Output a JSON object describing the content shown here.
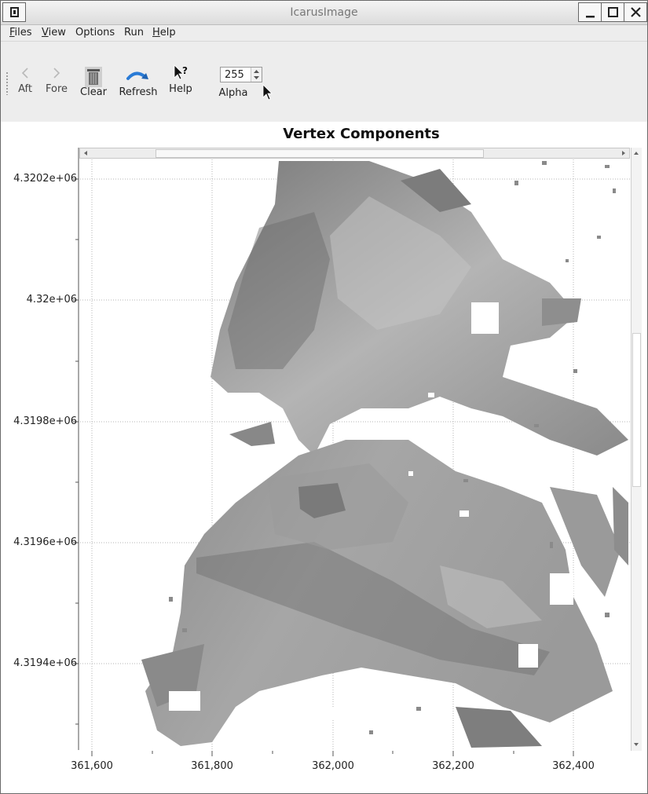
{
  "window": {
    "title": "IcarusImage"
  },
  "menu": [
    {
      "label": "Files",
      "mnemonic": "F",
      "rest": "iles"
    },
    {
      "label": "View",
      "mnemonic": "V",
      "rest": "iew"
    },
    {
      "label": "Options",
      "mnemonic": "",
      "rest": "Options"
    },
    {
      "label": "Run",
      "mnemonic": "",
      "rest": "Run"
    },
    {
      "label": "Help",
      "mnemonic": "H",
      "rest": "elp"
    }
  ],
  "toolbar": {
    "aft_label": "Aft",
    "fore_label": "Fore",
    "clear_label": "Clear",
    "refresh_label": "Refresh",
    "help_label": "Help",
    "alpha_label": "Alpha",
    "alpha_value": "255"
  },
  "chart": {
    "title": "Vertex Components",
    "y_ticks": [
      "4.3202e+06",
      "4.32e+06",
      "4.3198e+06",
      "4.3196e+06",
      "4.3194e+06"
    ],
    "x_ticks": [
      "361,600",
      "361,800",
      "362,000",
      "362,200",
      "362,400"
    ]
  },
  "chart_data": {
    "type": "heatmap",
    "title": "Vertex Components",
    "colormap": "grayscale",
    "x_ticks": [
      361600,
      361800,
      362000,
      362200,
      362400
    ],
    "y_ticks": [
      4320200,
      4320000,
      4319800,
      4319600,
      4319400
    ],
    "xlim": [
      361580,
      362500
    ],
    "ylim": [
      4319290,
      4320230
    ],
    "grid": true
  },
  "colors": {
    "window_bg": "#ededed",
    "plot_bg": "#ffffff",
    "grid": "#b0b0b0",
    "accent_refresh": "#2a7bd6"
  }
}
